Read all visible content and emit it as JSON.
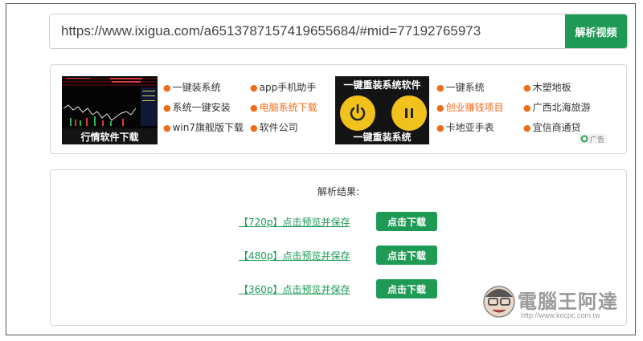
{
  "url_bar": {
    "value": "https://www.ixigua.com/a6513787157419655684/#mid=77192765973",
    "parse_button": "解析视频"
  },
  "ad_panel": {
    "left_image_caption": "行情软件下载",
    "right_image_top": "一键重装系统软件",
    "right_image_bottom": "一键重装系统",
    "col1": [
      "一键装系统",
      "系统一键安装",
      "win7旗舰版下载"
    ],
    "col2": [
      "app手机助手",
      "电脑系统下载",
      "软件公司"
    ],
    "col3": [
      "一键系统",
      "创业赚钱项目",
      "卡地亚手表"
    ],
    "col4": [
      "木塑地板",
      "广西北海旅游",
      "宜信商通贷"
    ],
    "ad_badge": "广告"
  },
  "results": {
    "title": "解析结果:",
    "rows": [
      {
        "link": "【720p】点击预览并保存",
        "button": "点击下载"
      },
      {
        "link": "【480p】点击预览并保存",
        "button": "点击下载"
      },
      {
        "link": "【360p】点击预览并保存",
        "button": "点击下载"
      }
    ]
  },
  "watermark": {
    "text": "電腦王阿達",
    "url": "http://www.kocpc.com.tw"
  },
  "colors": {
    "accent_green": "#1e9a55",
    "link_orange": "#ef6c1a",
    "border": "#d6d6d6"
  }
}
